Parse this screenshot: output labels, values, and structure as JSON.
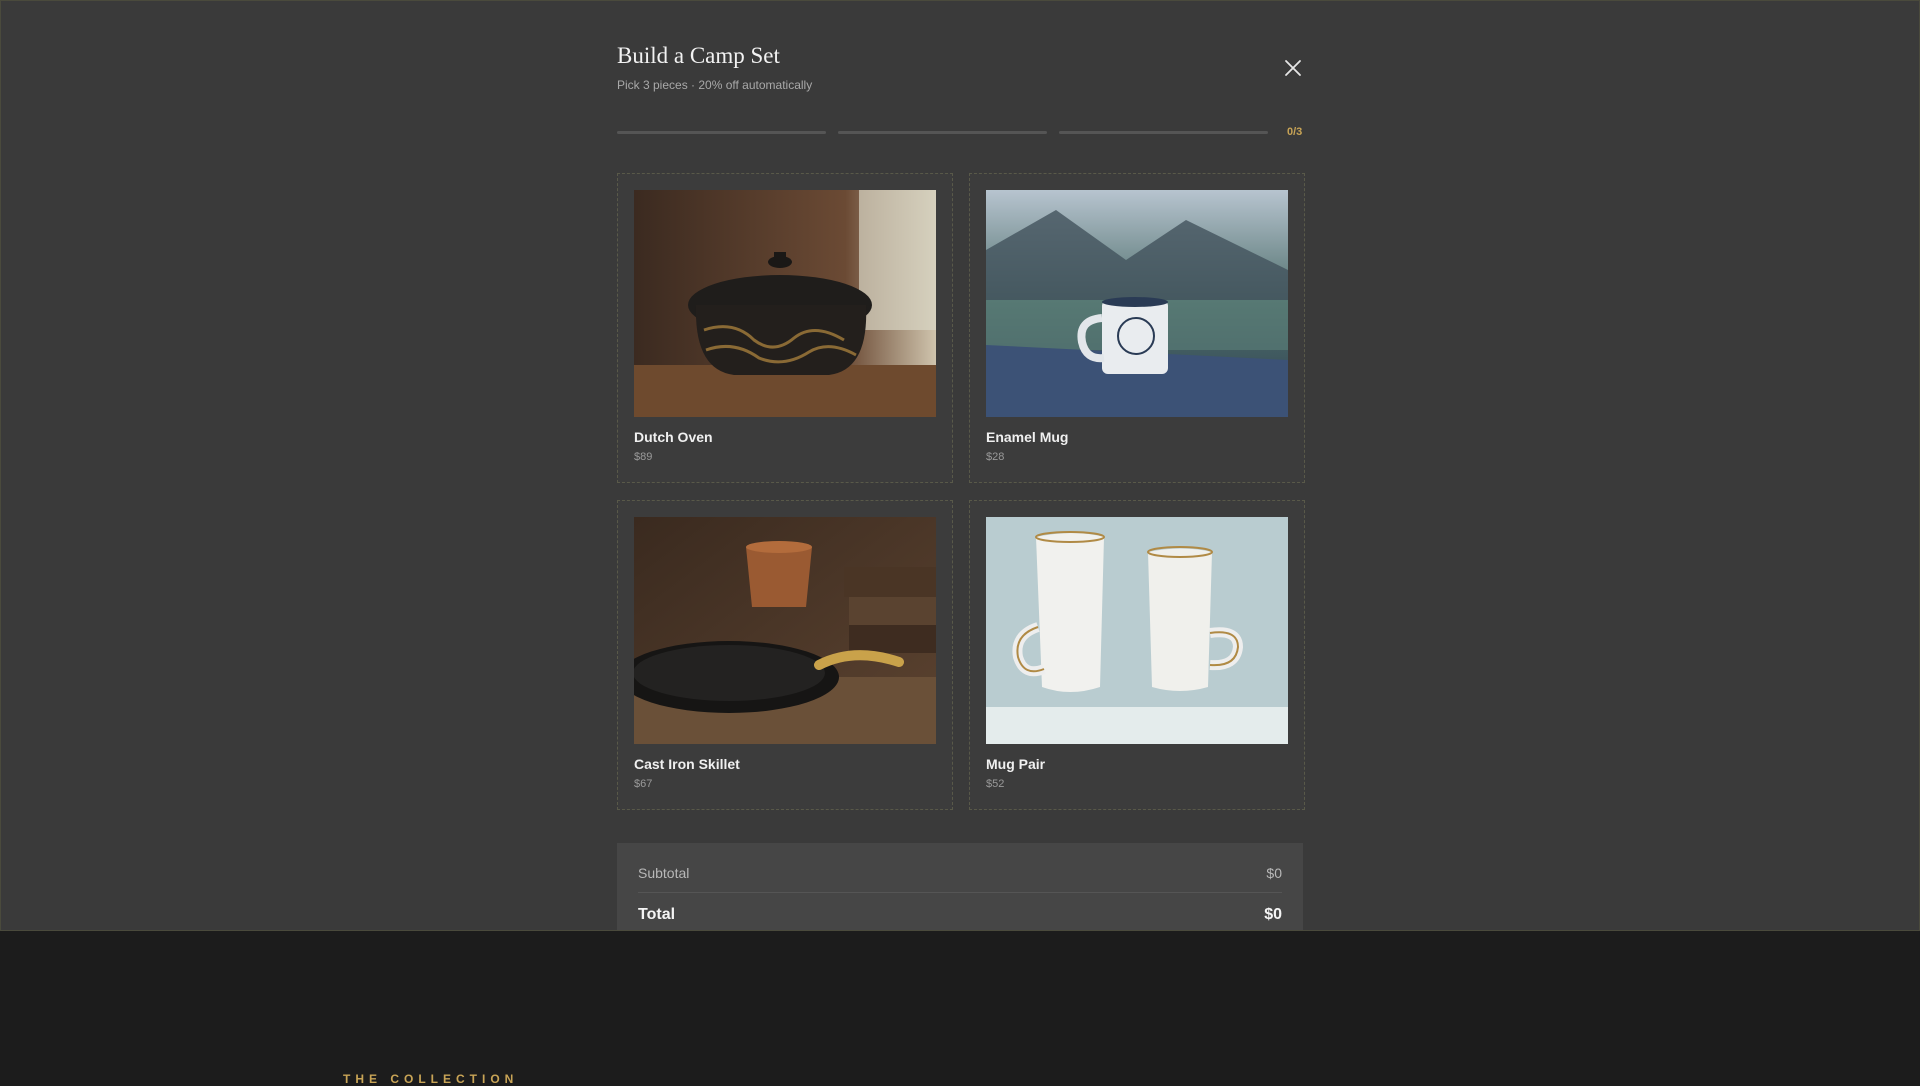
{
  "background": {
    "eyebrow": "THE COLLECTION"
  },
  "modal": {
    "title": "Build a Camp Set",
    "subtitle": "Pick 3 pieces · 20% off automatically",
    "close_icon": "close-icon",
    "progress": {
      "selected": 0,
      "total": 3,
      "label": "0/3"
    },
    "products": [
      {
        "name": "Dutch Oven",
        "price": "$89",
        "image": "dutch-oven-photo"
      },
      {
        "name": "Enamel Mug",
        "price": "$28",
        "image": "enamel-mug-photo"
      },
      {
        "name": "Cast Iron Skillet",
        "price": "$67",
        "image": "skillet-photo"
      },
      {
        "name": "Mug Pair",
        "price": "$52",
        "image": "mug-pair-photo"
      }
    ],
    "summary": {
      "subtotal_label": "Subtotal",
      "subtotal_value": "$0",
      "total_label": "Total",
      "total_value": "$0"
    }
  },
  "colors": {
    "accent": "#c8a456",
    "overlay_bg": "#3a3a3a",
    "page_bg": "#1c1c1c"
  }
}
